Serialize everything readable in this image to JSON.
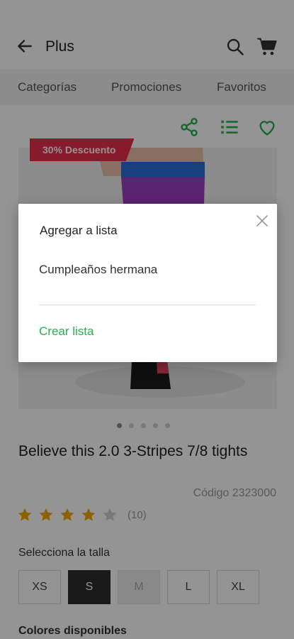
{
  "appbar": {
    "title": "Plus"
  },
  "tabs": [
    {
      "label": "Categorías"
    },
    {
      "label": "Promociones"
    },
    {
      "label": "Favoritos"
    }
  ],
  "product": {
    "badge": "30% Descuento",
    "title": "Believe this 2.0 3-Stripes 7/8 tights",
    "code": "Código 2323000",
    "rating": 4,
    "rating_max": 5,
    "reviews": "(10)",
    "carousel_count": 5,
    "carousel_active": 1
  },
  "sizes": {
    "label": "Selecciona la talla",
    "options": [
      {
        "label": "XS",
        "state": "normal"
      },
      {
        "label": "S",
        "state": "selected"
      },
      {
        "label": "M",
        "state": "disabled"
      },
      {
        "label": "L",
        "state": "normal"
      },
      {
        "label": "XL",
        "state": "normal"
      }
    ]
  },
  "colors": {
    "label": "Colores disponibles"
  },
  "dialog": {
    "title": "Agregar a lista",
    "lists": [
      "Cumpleaños hermana"
    ],
    "create_label": "Crear lista"
  },
  "theme": {
    "accent": "#22b14c",
    "badge": "#e8304a",
    "star": "#f2a900"
  }
}
